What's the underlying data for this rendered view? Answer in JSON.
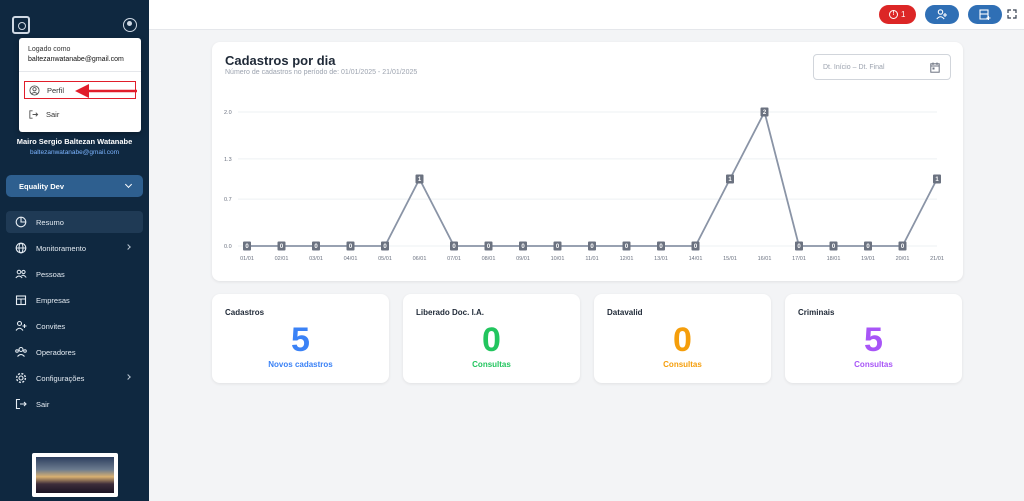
{
  "sidebar": {
    "user_name": "Mairo Sergio Baltezan Watanabe",
    "user_email": "baltezanwatanabe@gmail.com",
    "org": "Equality Dev",
    "items": [
      {
        "label": "Resumo",
        "icon": "pie-chart-icon",
        "arrow": false,
        "active": true
      },
      {
        "label": "Monitoramento",
        "icon": "globe-icon",
        "arrow": true,
        "active": false
      },
      {
        "label": "Pessoas",
        "icon": "people-icon",
        "arrow": false,
        "active": false
      },
      {
        "label": "Empresas",
        "icon": "building-icon",
        "arrow": false,
        "active": false
      },
      {
        "label": "Convites",
        "icon": "user-plus-icon",
        "arrow": false,
        "active": false
      },
      {
        "label": "Operadores",
        "icon": "operators-icon",
        "arrow": false,
        "active": false
      },
      {
        "label": "Configurações",
        "icon": "gear-icon",
        "arrow": true,
        "active": false
      },
      {
        "label": "Sair",
        "icon": "logout-icon",
        "arrow": false,
        "active": false
      }
    ]
  },
  "dropdown": {
    "caption": "Logado como",
    "email": "baltezanwatanabe@gmail.com",
    "profile_label": "Perfil",
    "logout_label": "Sair"
  },
  "topbar": {
    "alert_count": "1",
    "alert_color": "#dc2626",
    "button_color": "#2f6fb5"
  },
  "chart_card": {
    "date_start_placeholder": "Dt. Início",
    "date_separator": "–",
    "date_end_placeholder": "Dt. Final"
  },
  "chart_data": {
    "type": "line",
    "title": "Cadastros por dia",
    "subtitle": "Número de cadastros no período de: 01/01/2025 - 21/01/2025",
    "categories": [
      "01/01",
      "02/01",
      "03/01",
      "04/01",
      "05/01",
      "06/01",
      "07/01",
      "08/01",
      "09/01",
      "10/01",
      "11/01",
      "12/01",
      "13/01",
      "14/01",
      "15/01",
      "16/01",
      "17/01",
      "18/01",
      "19/01",
      "20/01",
      "21/01"
    ],
    "series": [
      {
        "values": [
          0,
          0,
          0,
          0,
          0,
          1,
          0,
          0,
          0,
          0,
          0,
          0,
          0,
          0,
          1,
          2,
          0,
          0,
          0,
          0,
          1
        ],
        "color": "#8a94a6"
      }
    ],
    "yticks": [
      "0.0",
      "0.7",
      "1.3",
      "2.0"
    ],
    "ylim": [
      0,
      2
    ],
    "grid": true
  },
  "stats": [
    {
      "title": "Cadastros",
      "value": "5",
      "sub": "Novos cadastros",
      "color": "#3b82f6"
    },
    {
      "title": "Liberado Doc. I.A.",
      "value": "0",
      "sub": "Consultas",
      "color": "#22c55e"
    },
    {
      "title": "Datavalid",
      "value": "0",
      "sub": "Consultas",
      "color": "#f59e0b"
    },
    {
      "title": "Criminais",
      "value": "5",
      "sub": "Consultas",
      "color": "#a855f7"
    }
  ]
}
